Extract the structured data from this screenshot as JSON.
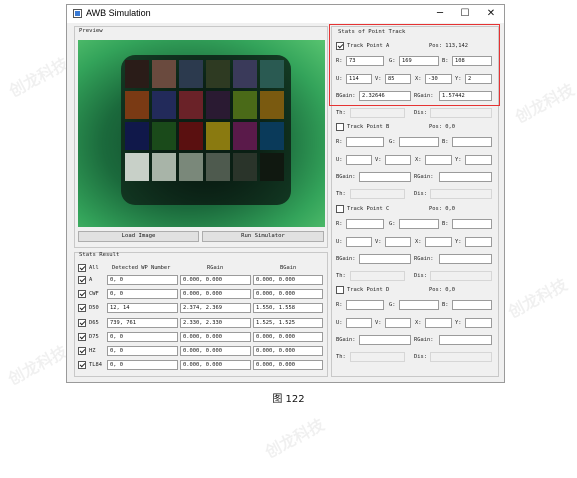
{
  "window": {
    "title": "AWB Simulation",
    "controls": [
      "─",
      "☐",
      "✕"
    ]
  },
  "preview": {
    "title": "Preview",
    "load_button": "Load Image",
    "run_button": "Run Simulator"
  },
  "stats": {
    "title": "Stats Result",
    "all_label": "All",
    "all_checked": true,
    "headers": [
      "Detected WP Number",
      "RGain",
      "BGain"
    ],
    "rows": [
      {
        "label": "A",
        "checked": true,
        "wp": "0, 0",
        "rgain": "0.000, 0.000",
        "bgain": "0.000, 0.000"
      },
      {
        "label": "CWF",
        "checked": true,
        "wp": "0, 0",
        "rgain": "0.000, 0.000",
        "bgain": "0.000, 0.000"
      },
      {
        "label": "D50",
        "checked": true,
        "wp": "12, 14",
        "rgain": "2.374, 2.369",
        "bgain": "1.550, 1.558"
      },
      {
        "label": "D65",
        "checked": true,
        "wp": "739, 761",
        "rgain": "2.330, 2.330",
        "bgain": "1.525, 1.525"
      },
      {
        "label": "D75",
        "checked": true,
        "wp": "0, 0",
        "rgain": "0.000, 0.000",
        "bgain": "0.000, 0.000"
      },
      {
        "label": "HZ",
        "checked": true,
        "wp": "0, 0",
        "rgain": "0.000, 0.000",
        "bgain": "0.000, 0.000"
      },
      {
        "label": "TL84",
        "checked": true,
        "wp": "0, 0",
        "rgain": "0.000, 0.000",
        "bgain": "0.000, 0.000"
      }
    ]
  },
  "track": {
    "title": "Stats of Point Track",
    "labels": {
      "r": "R:",
      "g": "G:",
      "b": "B:",
      "u": "U:",
      "v": "V:",
      "x": "X:",
      "y": "Y:",
      "bgain": "BGain:",
      "rgain": "RGain:",
      "th": "Th:",
      "dis": "Dis:"
    },
    "points": [
      {
        "name": "Track Point A",
        "checked": true,
        "pos": "Pos: 113,142",
        "r": "73",
        "g": "169",
        "b": "108",
        "u": "114",
        "v": "85",
        "x": "-30",
        "y": "2",
        "bgain": "2.32646",
        "rgain": "1.57442"
      },
      {
        "name": "Track Point B",
        "checked": false,
        "pos": "Pos: 0,0",
        "th": "",
        "dis": ""
      },
      {
        "name": "Track Point C",
        "checked": false,
        "pos": "Pos: 0,0",
        "th": "",
        "dis": ""
      },
      {
        "name": "Track Point D",
        "checked": false,
        "pos": "Pos: 0,0",
        "th": "",
        "dis": ""
      }
    ]
  },
  "watermark": "创龙科技",
  "caption": "图 122",
  "colors": {
    "accent": "#e53333",
    "preview_green": "#33a35a"
  }
}
